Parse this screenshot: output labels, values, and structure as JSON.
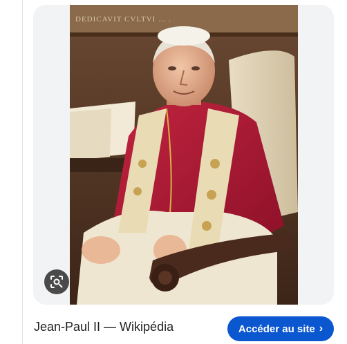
{
  "result": {
    "source_title": "Jean-Paul II — Wikipédia",
    "visit_label": "Accéder au site",
    "visit_chevron": "›",
    "lens_icon": "lens-search-icon",
    "image_subject": "portrait",
    "inscription": "DEDICAVIT CVLTVI ... ."
  },
  "colors": {
    "button": "#0b57d0",
    "card": "#f1f3f4",
    "text": "#202124"
  }
}
